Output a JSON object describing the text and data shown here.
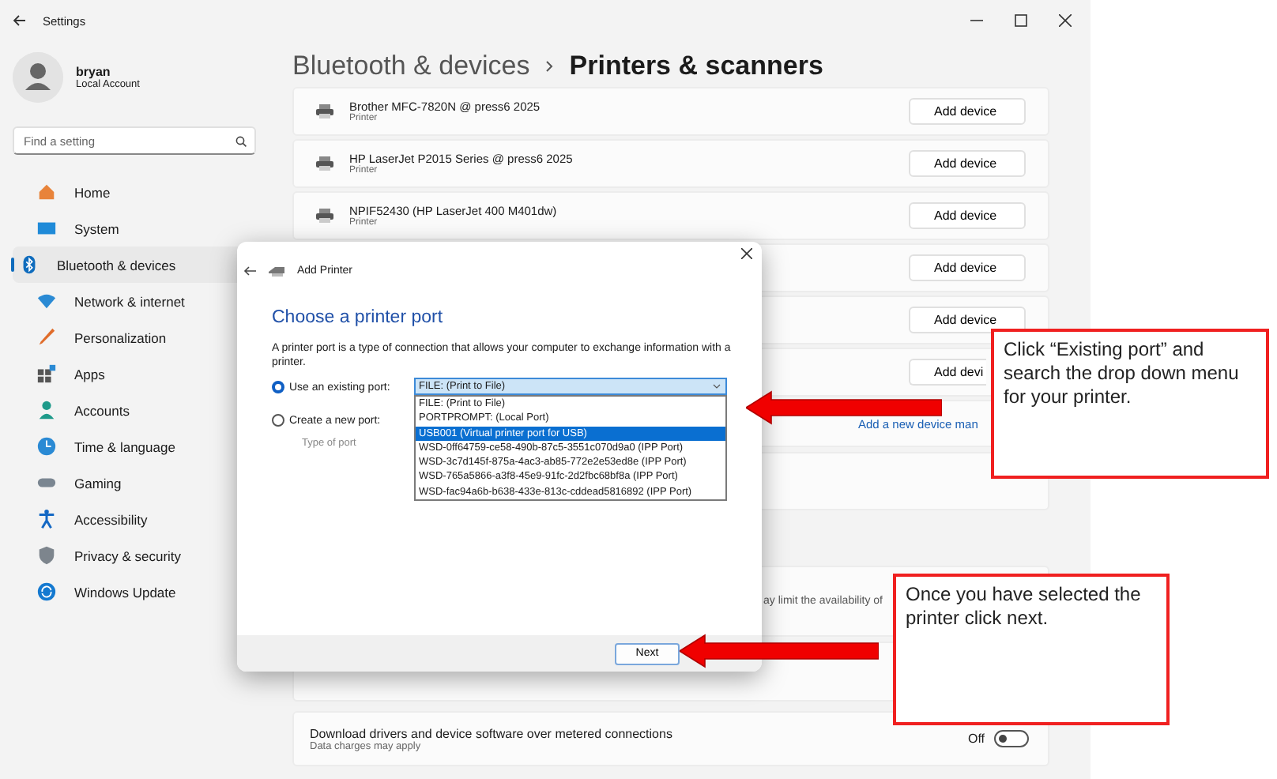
{
  "window": {
    "title": "Settings"
  },
  "profile": {
    "name": "bryan",
    "account_type": "Local Account"
  },
  "search": {
    "placeholder": "Find a setting"
  },
  "nav": [
    {
      "label": "Home",
      "selected": false
    },
    {
      "label": "System",
      "selected": false
    },
    {
      "label": "Bluetooth & devices",
      "selected": true
    },
    {
      "label": "Network & internet",
      "selected": false
    },
    {
      "label": "Personalization",
      "selected": false
    },
    {
      "label": "Apps",
      "selected": false
    },
    {
      "label": "Accounts",
      "selected": false
    },
    {
      "label": "Time & language",
      "selected": false
    },
    {
      "label": "Gaming",
      "selected": false
    },
    {
      "label": "Accessibility",
      "selected": false
    },
    {
      "label": "Privacy & security",
      "selected": false
    },
    {
      "label": "Windows Update",
      "selected": false
    }
  ],
  "breadcrumb": {
    "parent": "Bluetooth & devices",
    "current": "Printers & scanners"
  },
  "devices": [
    {
      "name": "Brother MFC-7820N @ press6 2025",
      "type": "Printer",
      "button": "Add device"
    },
    {
      "name": "HP LaserJet P2015 Series @ press6 2025",
      "type": "Printer",
      "button": "Add device"
    },
    {
      "name": "NPIF52430 (HP LaserJet 400 M401dw)",
      "type": "Printer",
      "button": "Add device"
    },
    {
      "button": "Add device"
    },
    {
      "button": "Add device"
    },
    {
      "button": "Add devi"
    }
  ],
  "add_manually_link": "Add a new device man",
  "notice_fragment": "ay limit the availability of",
  "metered": {
    "title": "Download drivers and device software over metered connections",
    "subtitle": "Data charges may apply",
    "state_label": "Off",
    "on": false
  },
  "dialog": {
    "title": "Add Printer",
    "heading": "Choose a printer port",
    "description": "A printer port is a type of connection that allows your computer to exchange information with a printer.",
    "options": [
      {
        "label": "Use an existing port:",
        "selected": true
      },
      {
        "label": "Create a new port:",
        "selected": false
      }
    ],
    "port_type_label": "Type of port",
    "combo_value": "FILE: (Print to File)",
    "port_list": [
      {
        "label": "FILE: (Print to File)",
        "selected": false
      },
      {
        "label": "PORTPROMPT: (Local Port)",
        "selected": false
      },
      {
        "label": "USB001 (Virtual printer port for USB)",
        "selected": true
      },
      {
        "label": "WSD-0ff64759-ce58-490b-87c5-3551c070d9a0 (IPP Port)",
        "selected": false
      },
      {
        "label": "WSD-3c7d145f-875a-4ac3-ab85-772e2e53ed8e (IPP Port)",
        "selected": false
      },
      {
        "label": "WSD-765a5866-a3f8-45e9-91fc-2d2fbc68bf8a (IPP Port)",
        "selected": false
      },
      {
        "label": "WSD-fac94a6b-b638-433e-813c-cddead5816892 (IPP Port)",
        "selected": false
      }
    ],
    "next_button": "Next"
  },
  "annotations": [
    {
      "text": "Click “Existing port” and search the drop down menu for your printer."
    },
    {
      "text": "Once you have selected the printer click next."
    }
  ]
}
